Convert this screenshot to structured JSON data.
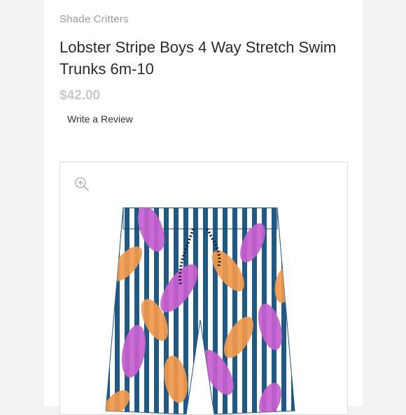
{
  "product": {
    "brand": "Shade Critters",
    "title": "Lobster Stripe Boys 4 Way Stretch Swim Trunks 6m-10",
    "price": "$42.00",
    "review_link": "Write a Review"
  },
  "gallery": {
    "zoom_icon": "zoom-in-icon",
    "image_subject": "swim-trunks",
    "colors": {
      "stripe_dark": "#1f5a87",
      "stripe_light": "#ffffff",
      "lobster_pink": "#c85fd0",
      "lobster_orange": "#f29a4a",
      "drawstring": "#1a1a2e"
    }
  }
}
